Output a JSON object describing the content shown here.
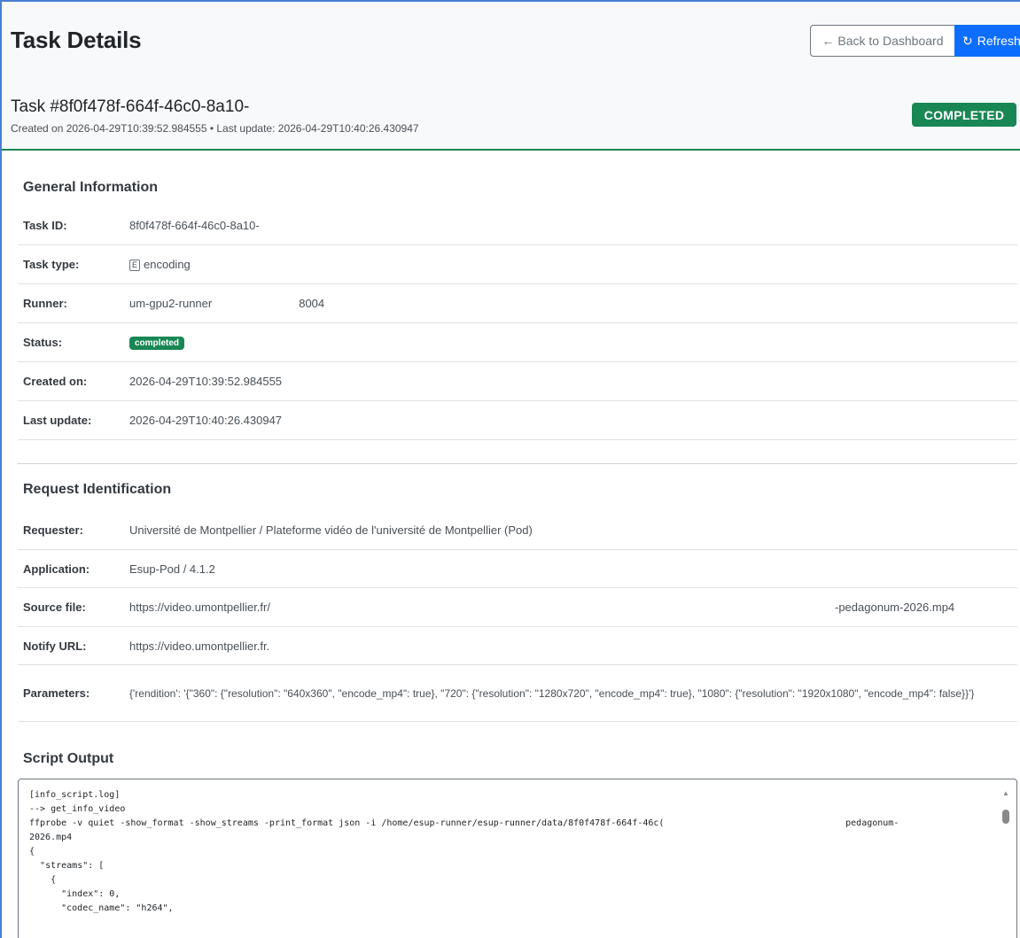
{
  "header": {
    "title": "Task Details",
    "back_label": "← Back to Dashboard",
    "refresh_label": "Refresh",
    "refresh_icon": "refresh-icon"
  },
  "task_card": {
    "title": "Task #8f0f478f-664f-46c0-8a10-",
    "meta": "Created on 2026-04-29T10:39:52.984555 • Last update: 2026-04-29T10:40:26.430947",
    "status_badge": "COMPLETED",
    "status_color": "#198754"
  },
  "general": {
    "title": "General Information",
    "rows": [
      {
        "label": "Task ID:",
        "value": "8f0f478f-664f-46c0-8a10-"
      },
      {
        "label": "Task type:",
        "badge": "E",
        "value": "encoding"
      },
      {
        "label": "Runner:",
        "value": "um-gpu2-runner",
        "port": "8004"
      },
      {
        "label": "Status:",
        "value": "completed"
      },
      {
        "label": "Created on:",
        "value": "2026-04-29T10:39:52.984555"
      },
      {
        "label": "Last update:",
        "value": "2026-04-29T10:40:26.430947"
      }
    ]
  },
  "request": {
    "title": "Request Identification",
    "rows": [
      {
        "label": "Requester:",
        "value": "Université de Montpellier / Plateforme vidéo de l'université de Montpellier (Pod)"
      },
      {
        "label": "Application:",
        "value": "Esup-Pod / 4.1.2"
      },
      {
        "label": "Source file:",
        "value": "https://video.umontpellier.fr/",
        "suffix": "-pedagonum-2026.mp4"
      },
      {
        "label": "Notify URL:",
        "value": "https://video.umontpellier.fr."
      },
      {
        "label": "Parameters:",
        "value": "{'rendition': '{\"360\": {\"resolution\": \"640x360\", \"encode_mp4\": true}, \"720\": {\"resolution\": \"1280x720\", \"encode_mp4\": true}, \"1080\": {\"resolution\": \"1920x1080\", \"encode_mp4\": false}}'}"
      }
    ]
  },
  "script": {
    "title": "Script Output",
    "output": "[info_script.log]\n--> get_info_video\nffprobe -v quiet -show_format -show_streams -print_format json -i /home/esup-runner/esup-runner/data/8f0f478f-664f-46c(                                  pedagonum-\n2026.mp4\n{\n  \"streams\": [\n    {\n      \"index\": 0,\n      \"codec_name\": \"h264\","
  }
}
